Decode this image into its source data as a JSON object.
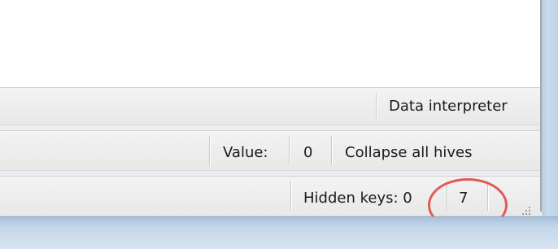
{
  "toolbar_top": {
    "data_interpreter_label": "Data interpreter"
  },
  "toolbar_value": {
    "value_label": "Value:",
    "value_number": "0",
    "collapse_label": "Collapse all hives"
  },
  "statusbar": {
    "hidden_keys_label": "Hidden keys: 0",
    "hidden_keys_count": "7"
  },
  "colors": {
    "highlight_circle": "#e35a55"
  },
  "icons": {
    "resize_grip": "resize-grip-icon"
  }
}
